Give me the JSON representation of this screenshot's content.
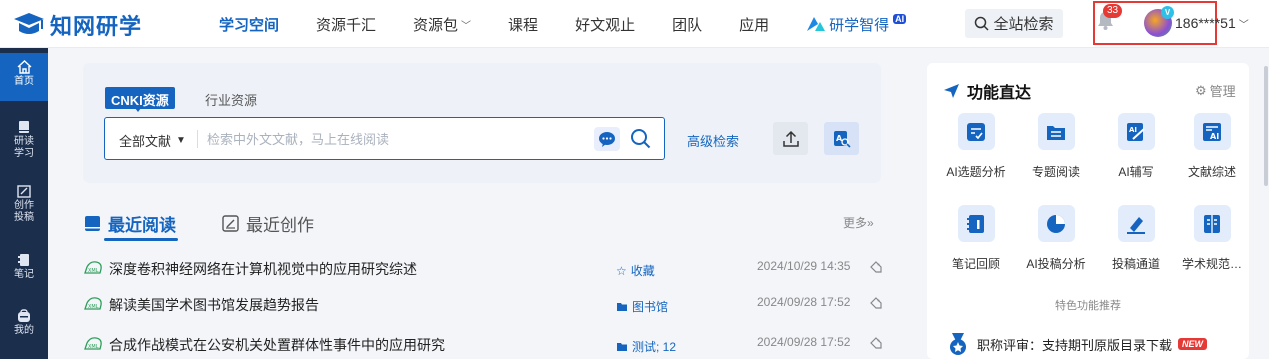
{
  "logo": {
    "text": "知网研学"
  },
  "nav": [
    {
      "label": "学习空间",
      "active": true,
      "dropdown": false
    },
    {
      "label": "资源千汇",
      "active": false,
      "dropdown": false
    },
    {
      "label": "资源包",
      "active": false,
      "dropdown": true
    },
    {
      "label": "课程",
      "active": false,
      "dropdown": false
    },
    {
      "label": "好文观止",
      "active": false,
      "dropdown": false
    },
    {
      "label": "团队",
      "active": false,
      "dropdown": false
    },
    {
      "label": "应用",
      "active": false,
      "dropdown": false
    }
  ],
  "ai_nav": {
    "label": "研学智得",
    "badge": "AI"
  },
  "global_search": {
    "label": "全站检索"
  },
  "notifications": {
    "count": "33"
  },
  "user": {
    "name": "186****51",
    "badge": "V"
  },
  "sidebar": [
    {
      "label": "首页",
      "icon": "home-icon",
      "active": true
    },
    {
      "label": "研读\n学习",
      "icon": "book-icon",
      "active": false
    },
    {
      "label": "创作\n投稿",
      "icon": "edit-icon",
      "active": false
    },
    {
      "label": "笔记",
      "icon": "note-icon",
      "active": false
    },
    {
      "label": "我的",
      "icon": "user-icon",
      "active": false
    }
  ],
  "search": {
    "tabs": [
      "CNKI资源",
      "行业资源"
    ],
    "scope": "全部文献",
    "placeholder": "检索中外文文献，马上在线阅读",
    "advanced": "高级检索"
  },
  "recent": {
    "tab_active": "最近阅读",
    "tab_inactive": "最近创作",
    "more": "更多»",
    "items": [
      {
        "title": "深度卷积神经网络在计算机视觉中的应用研究综述",
        "folder": "收藏",
        "folder_icon": "star-icon",
        "time": "2024/10/29 14:35"
      },
      {
        "title": "解读美国学术图书馆发展趋势报告",
        "folder": "图书馆",
        "folder_icon": "folder-icon",
        "time": "2024/09/28 17:52"
      },
      {
        "title": "合成作战模式在公安机关处置群体性事件中的应用研究",
        "folder": "测试; 12",
        "folder_icon": "folder-icon",
        "time": "2024/09/28 17:52"
      }
    ]
  },
  "panel": {
    "title": "功能直达",
    "manage": "管理",
    "functions": [
      {
        "label": "AI选题分析",
        "icon": "ai-topic-icon"
      },
      {
        "label": "专题阅读",
        "icon": "topic-reading-icon"
      },
      {
        "label": "AI辅写",
        "icon": "ai-write-icon"
      },
      {
        "label": "文献综述",
        "icon": "review-icon"
      },
      {
        "label": "笔记回顾",
        "icon": "note-review-icon"
      },
      {
        "label": "AI投稿分析",
        "icon": "pie-chart-icon"
      },
      {
        "label": "投稿通道",
        "icon": "submit-icon"
      },
      {
        "label": "学术规范…",
        "icon": "norm-icon"
      }
    ],
    "featured_label": "特色功能推荐",
    "promo": {
      "text": "职称评审：支持期刊原版目录下载",
      "badge": "NEW"
    }
  },
  "colors": {
    "primary": "#1565c0",
    "sidebar": "#1b2e4b",
    "alert": "#e53935"
  }
}
